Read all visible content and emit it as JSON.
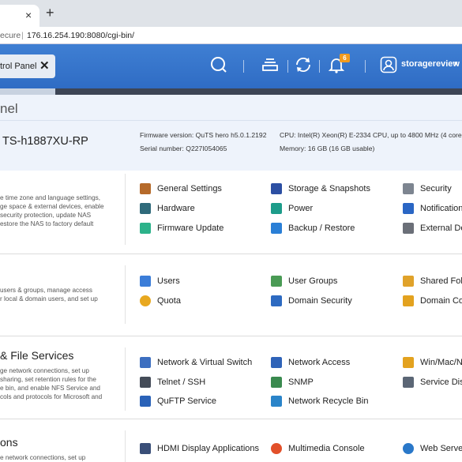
{
  "browser": {
    "new_tab_glyph": "+",
    "close_glyph": "×",
    "address": {
      "secure_label": "ecure",
      "url": "176.16.254.190:8080/cgi-bin/"
    }
  },
  "topbar": {
    "app_tab_label": "trol Panel",
    "app_tab_close": "✕",
    "notification_count": "6",
    "username": "storagereview",
    "user_caret": "▾",
    "icons": [
      "search-icon",
      "stack-icon",
      "sync-icon",
      "bell-icon",
      "user-icon"
    ]
  },
  "header": {
    "title": "nel",
    "model": "TS-h1887XU-RP",
    "firmware": "Firmware version:  QuTS hero h5.0.1.2192",
    "serial": "Serial number:  Q227I054065",
    "cpu": "CPU:  Intel(R) Xeon(R) E-2334 CPU, up to 4800 MHz (4 cores,",
    "memory": "Memory:  16 GB (16 GB usable)"
  },
  "sections": {
    "system": {
      "desc": [
        "e time zone and language settings,",
        "ge space & external devices, enable",
        "security protection, update NAS",
        "estore the NAS to factory default"
      ],
      "items": [
        {
          "label": "General Settings",
          "icon": "general-settings-icon",
          "color": "#b56a2a"
        },
        {
          "label": "Storage & Snapshots",
          "icon": "storage-icon",
          "color": "#2c4fa3"
        },
        {
          "label": "Security",
          "icon": "lock-icon",
          "color": "#7d8590"
        },
        {
          "label": "Hardware",
          "icon": "hardware-icon",
          "color": "#2f6a7a"
        },
        {
          "label": "Power",
          "icon": "power-icon",
          "color": "#1d9c8a"
        },
        {
          "label": "Notification",
          "icon": "notification-icon",
          "color": "#2a66c4"
        },
        {
          "label": "Firmware Update",
          "icon": "firmware-icon",
          "color": "#2cb28a"
        },
        {
          "label": "Backup / Restore",
          "icon": "backup-icon",
          "color": "#2a7fd6"
        },
        {
          "label": "External De",
          "icon": "external-device-icon",
          "color": "#6b6f78"
        }
      ]
    },
    "privilege": {
      "desc": [
        "users & groups, manage access",
        "r local & domain users, and set up"
      ],
      "items": [
        {
          "label": "Users",
          "icon": "users-icon",
          "color": "#3b7dd8"
        },
        {
          "label": "User Groups",
          "icon": "user-groups-icon",
          "color": "#4a9b55"
        },
        {
          "label": "Shared Fold",
          "icon": "shared-folder-icon",
          "color": "#e0a22a"
        },
        {
          "label": "Quota",
          "icon": "quota-icon",
          "color": "#e8a820"
        },
        {
          "label": "Domain Security",
          "icon": "domain-security-icon",
          "color": "#2d6ac1"
        },
        {
          "label": "Domain Con",
          "icon": "domain-controller-icon",
          "color": "#e3a21f"
        }
      ]
    },
    "network": {
      "title": "& File Services",
      "desc": [
        "ge network connections, set up",
        "sharing, set retention rules for the",
        "e bin, and enable NFS Service and",
        "cols and protocols for Microsoft and"
      ],
      "items": [
        {
          "label": "Network & Virtual Switch",
          "icon": "network-switch-icon",
          "color": "#3d6fc0"
        },
        {
          "label": "Network Access",
          "icon": "network-access-icon",
          "color": "#2f63b8"
        },
        {
          "label": "Win/Mac/N",
          "icon": "win-mac-icon",
          "color": "#e3a21f"
        },
        {
          "label": "Telnet / SSH",
          "icon": "terminal-icon",
          "color": "#444c58"
        },
        {
          "label": "SNMP",
          "icon": "snmp-icon",
          "color": "#3a8a4f"
        },
        {
          "label": "Service Disc",
          "icon": "service-discovery-icon",
          "color": "#5b6675"
        },
        {
          "label": "QuFTP Service",
          "icon": "ftp-icon",
          "color": "#2a62b8"
        },
        {
          "label": "Network Recycle Bin",
          "icon": "recycle-bin-icon",
          "color": "#2a84c9"
        }
      ]
    },
    "applications": {
      "title": "ons",
      "desc": [
        "e network connections, set up"
      ],
      "items": [
        {
          "label": "HDMI Display Applications",
          "icon": "hdmi-icon",
          "color": "#3a4f78"
        },
        {
          "label": "Multimedia Console",
          "icon": "multimedia-icon",
          "color": "#e2502a"
        },
        {
          "label": "Web Server",
          "icon": "web-server-icon",
          "color": "#2a78c9"
        }
      ]
    }
  }
}
